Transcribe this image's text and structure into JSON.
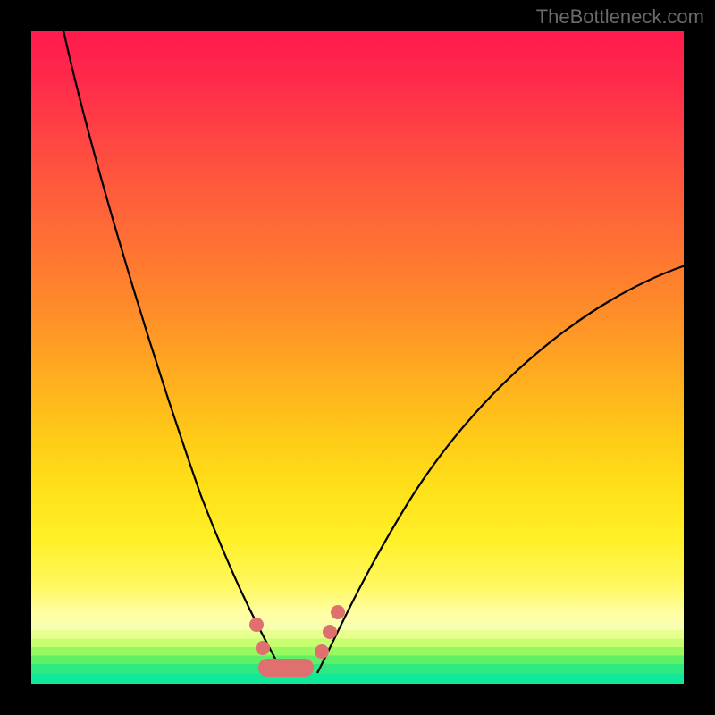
{
  "watermark": "TheBottleneck.com",
  "colors": {
    "frame": "#000000",
    "gradient_top": "#ff1a4d",
    "gradient_mid": "#ffca18",
    "gradient_bottom": "#10e89a",
    "curve": "#000000",
    "markers": "#e07070"
  },
  "chart_data": {
    "type": "line",
    "title": "",
    "xlabel": "",
    "ylabel": "",
    "xlim": [
      0,
      100
    ],
    "ylim": [
      0,
      100
    ],
    "note": "No axis ticks or grid present; values estimated from pixel positions on a 0–100 normalized scale (origin at bottom-left of plot area).",
    "series": [
      {
        "name": "left-branch",
        "x": [
          5,
          10,
          15,
          20,
          25,
          30,
          33,
          36,
          38
        ],
        "y": [
          100,
          82,
          64,
          47,
          31,
          17,
          9,
          4,
          2
        ]
      },
      {
        "name": "right-branch",
        "x": [
          44,
          46,
          49,
          53,
          60,
          70,
          80,
          90,
          100
        ],
        "y": [
          2,
          4,
          8,
          14,
          24,
          37,
          48,
          57,
          64
        ]
      }
    ],
    "valley_segment": {
      "name": "valley-pill",
      "x": [
        35.5,
        42.5
      ],
      "y": [
        2,
        2
      ]
    },
    "markers": {
      "left": [
        {
          "x": 34.5,
          "y": 9.0
        },
        {
          "x": 35.5,
          "y": 5.5
        }
      ],
      "right": [
        {
          "x": 44.5,
          "y": 5.0
        },
        {
          "x": 45.8,
          "y": 8.0
        },
        {
          "x": 47.0,
          "y": 11.0
        }
      ]
    }
  }
}
